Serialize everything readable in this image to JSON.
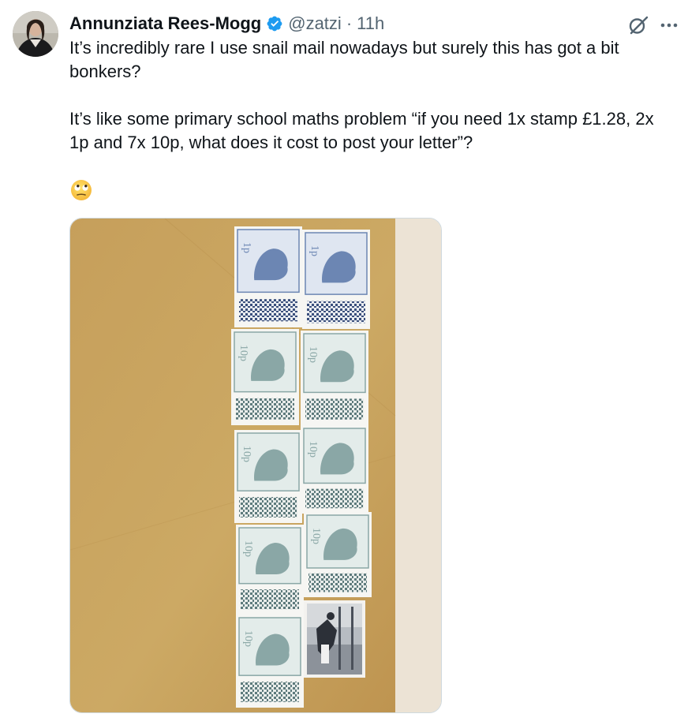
{
  "author": {
    "name": "Annunziata Rees-Mogg",
    "handle": "@zatzi",
    "separator": "·",
    "time": "11h",
    "verified": true
  },
  "tweet": {
    "paragraphs": [
      "It’s incredibly rare I use snail mail nowadays but surely this has got a bit bonkers?",
      "It’s like some primary school maths problem “if you need 1x stamp £1.28, 2x 1p and 7x 10p, what does it cost to post your letter”?"
    ],
    "emoji": "face-with-rolling-eyes"
  },
  "icons": {
    "verified": "verified-badge-icon",
    "grok": "grok-icon",
    "more": "more-options-icon"
  },
  "colors": {
    "text": "#0f1419",
    "secondary": "#536471",
    "verified_blue": "#1d9bf0",
    "envelope": "#c9a463",
    "stamp_1p": "#6c86b3",
    "stamp_10p": "#8aa7a6"
  },
  "image": {
    "stamps": {
      "denomination_1p": "1p",
      "denomination_10p": "10p"
    }
  }
}
